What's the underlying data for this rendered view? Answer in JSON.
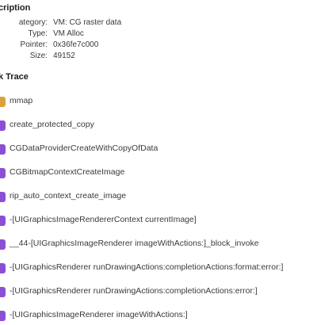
{
  "description": {
    "title": "cription",
    "rows": [
      {
        "key": "ategory:",
        "value": "VM: CG raster data"
      },
      {
        "key": "Type:",
        "value": "VM Alloc"
      },
      {
        "key": "Pointer:",
        "value": "0x36fe7c000"
      },
      {
        "key": "Size:",
        "value": "49152"
      }
    ]
  },
  "stack_trace": {
    "title": "k Trace",
    "frames": [
      {
        "label": "mmap",
        "kind": "library",
        "color": "#d9a23a"
      },
      {
        "label": "create_protected_copy",
        "kind": "user",
        "color": "#8b4fd6"
      },
      {
        "label": "CGDataProviderCreateWithCopyOfData",
        "kind": "user",
        "color": "#8b4fd6"
      },
      {
        "label": "CGBitmapContextCreateImage",
        "kind": "user",
        "color": "#8b4fd6"
      },
      {
        "label": "rip_auto_context_create_image",
        "kind": "user",
        "color": "#8b4fd6"
      },
      {
        "label": "-[UIGraphicsImageRendererContext currentImage]",
        "kind": "user",
        "color": "#8b4fd6"
      },
      {
        "label": "__44-[UIGraphicsImageRenderer imageWithActions:]_block_invoke",
        "kind": "user",
        "color": "#8b4fd6"
      },
      {
        "label": "-[UIGraphicsRenderer runDrawingActions:completionActions:format:error:]",
        "kind": "user",
        "color": "#8b4fd6"
      },
      {
        "label": "-[UIGraphicsRenderer runDrawingActions:completionActions:error:]",
        "kind": "user",
        "color": "#8b4fd6"
      },
      {
        "label": "-[UIGraphicsImageRenderer imageWithActions:]",
        "kind": "user",
        "color": "#8b4fd6"
      }
    ]
  }
}
